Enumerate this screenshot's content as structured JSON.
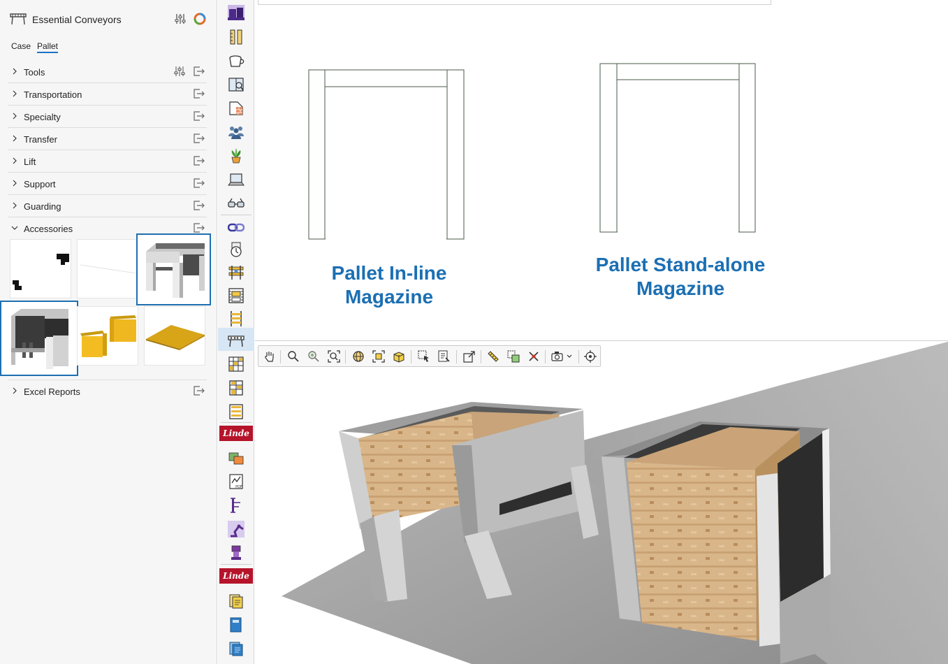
{
  "panel": {
    "title": "Essential Conveyors",
    "tabs": [
      "Case",
      "Pallet"
    ],
    "active_tab": "Pallet",
    "sections": [
      {
        "label": "Tools",
        "expanded": false
      },
      {
        "label": "Transportation",
        "expanded": false
      },
      {
        "label": "Specialty",
        "expanded": false
      },
      {
        "label": "Transfer",
        "expanded": false
      },
      {
        "label": "Lift",
        "expanded": false
      },
      {
        "label": "Support",
        "expanded": false
      },
      {
        "label": "Guarding",
        "expanded": false
      },
      {
        "label": "Accessories",
        "expanded": true
      },
      {
        "label": "Excel Reports",
        "expanded": false
      }
    ],
    "accessory_thumbnails": [
      {
        "icon": "black-brackets",
        "selected": false
      },
      {
        "icon": "blank-line",
        "selected": false
      },
      {
        "icon": "pallet-standalone-magazine",
        "selected": true
      },
      {
        "icon": "pallet-inline-magazine",
        "selected": true
      },
      {
        "icon": "yellow-guards",
        "selected": false
      },
      {
        "icon": "yellow-plate",
        "selected": false
      }
    ]
  },
  "toolbar_icons": [
    "purple-boxes-icon",
    "ruler-icon",
    "cup-icon",
    "book-icon",
    "wall-icon",
    "people-icon",
    "plant-icon",
    "laptop-icon",
    "glasses-icon",
    "chain-icon",
    "timer-icon",
    "rack-icon",
    "film-icon",
    "ladder-icon",
    "conveyor-icon",
    "shelf-grid-icon",
    "shelf-icon",
    "shelf-stack-icon",
    "linde-logo-icon",
    "layers-icon",
    "pdf-report-icon",
    "beam-icon",
    "robot-arm-icon",
    "station-icon",
    "linde-logo-icon",
    "yellow-pages-icon",
    "blue-book-icon",
    "blue-pages-icon"
  ],
  "labels": {
    "inline_line1": "Pallet In-line",
    "inline_line2": "Magazine",
    "standalone_line1": "Pallet Stand-alone",
    "standalone_line2": "Magazine"
  },
  "viewer_toolbar": [
    "hand-icon",
    "zoom-icon",
    "zoom-in-icon",
    "zoom-fit-icon",
    "globe-icon",
    "frame-icon",
    "box-view-icon",
    "select-icon",
    "properties-icon",
    "expand-icon",
    "measure-icon",
    "copy-icon",
    "delete-icon",
    "camera-icon",
    "target-icon"
  ],
  "colors": {
    "accent": "#1b6fb3",
    "selection_border": "#1e6fb1",
    "active_toolbar": "#d6e6f4",
    "panel_bg": "#f6f6f6",
    "frame_grey": "#bfbfbf",
    "wood": "#d8b88c",
    "floor": "#9a9a9a"
  }
}
